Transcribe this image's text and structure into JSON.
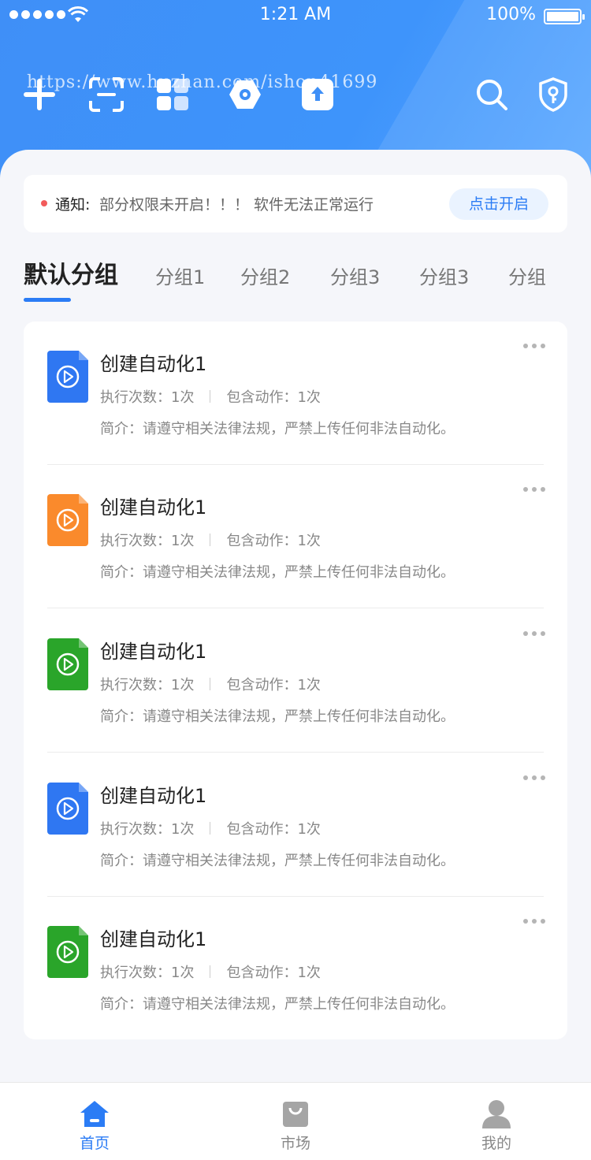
{
  "status_bar": {
    "time": "1:21 AM",
    "battery": "100%"
  },
  "header": {
    "watermark": "https://www.huzhan.com/ishop41699",
    "toolbar_icons": [
      "add-icon",
      "scan-icon",
      "apps-icon",
      "gear-icon",
      "upload-icon",
      "search-icon",
      "shield-key-icon"
    ]
  },
  "notice": {
    "label": "通知:",
    "message": "部分权限未开启！！！ 软件无法正常运行",
    "button": "点击开启"
  },
  "tabs": [
    "默认分组",
    "分组1",
    "分组2",
    "分组3",
    "分组3",
    "分组"
  ],
  "items": [
    {
      "title": "创建自动化1",
      "exec": "执行次数：1次",
      "actions": "包含动作：1次",
      "desc": "简介：请遵守相关法律法规，严禁上传任何非法自动化。",
      "color": "#2f77f2"
    },
    {
      "title": "创建自动化1",
      "exec": "执行次数：1次",
      "actions": "包含动作：1次",
      "desc": "简介：请遵守相关法律法规，严禁上传任何非法自动化。",
      "color": "#fa8a2c"
    },
    {
      "title": "创建自动化1",
      "exec": "执行次数：1次",
      "actions": "包含动作：1次",
      "desc": "简介：请遵守相关法律法规，严禁上传任何非法自动化。",
      "color": "#2aa52a"
    },
    {
      "title": "创建自动化1",
      "exec": "执行次数：1次",
      "actions": "包含动作：1次",
      "desc": "简介：请遵守相关法律法规，严禁上传任何非法自动化。",
      "color": "#2f77f2"
    },
    {
      "title": "创建自动化1",
      "exec": "执行次数：1次",
      "actions": "包含动作：1次",
      "desc": "简介：请遵守相关法律法规，严禁上传任何非法自动化。",
      "color": "#2aa52a"
    }
  ],
  "bottom_nav": [
    {
      "label": "首页",
      "icon": "home-icon",
      "active": true
    },
    {
      "label": "市场",
      "icon": "market-bag-icon",
      "active": false
    },
    {
      "label": "我的",
      "icon": "profile-icon",
      "active": false
    }
  ],
  "colors": {
    "accent": "#2b7cf5",
    "header": "#3f8ff7"
  }
}
